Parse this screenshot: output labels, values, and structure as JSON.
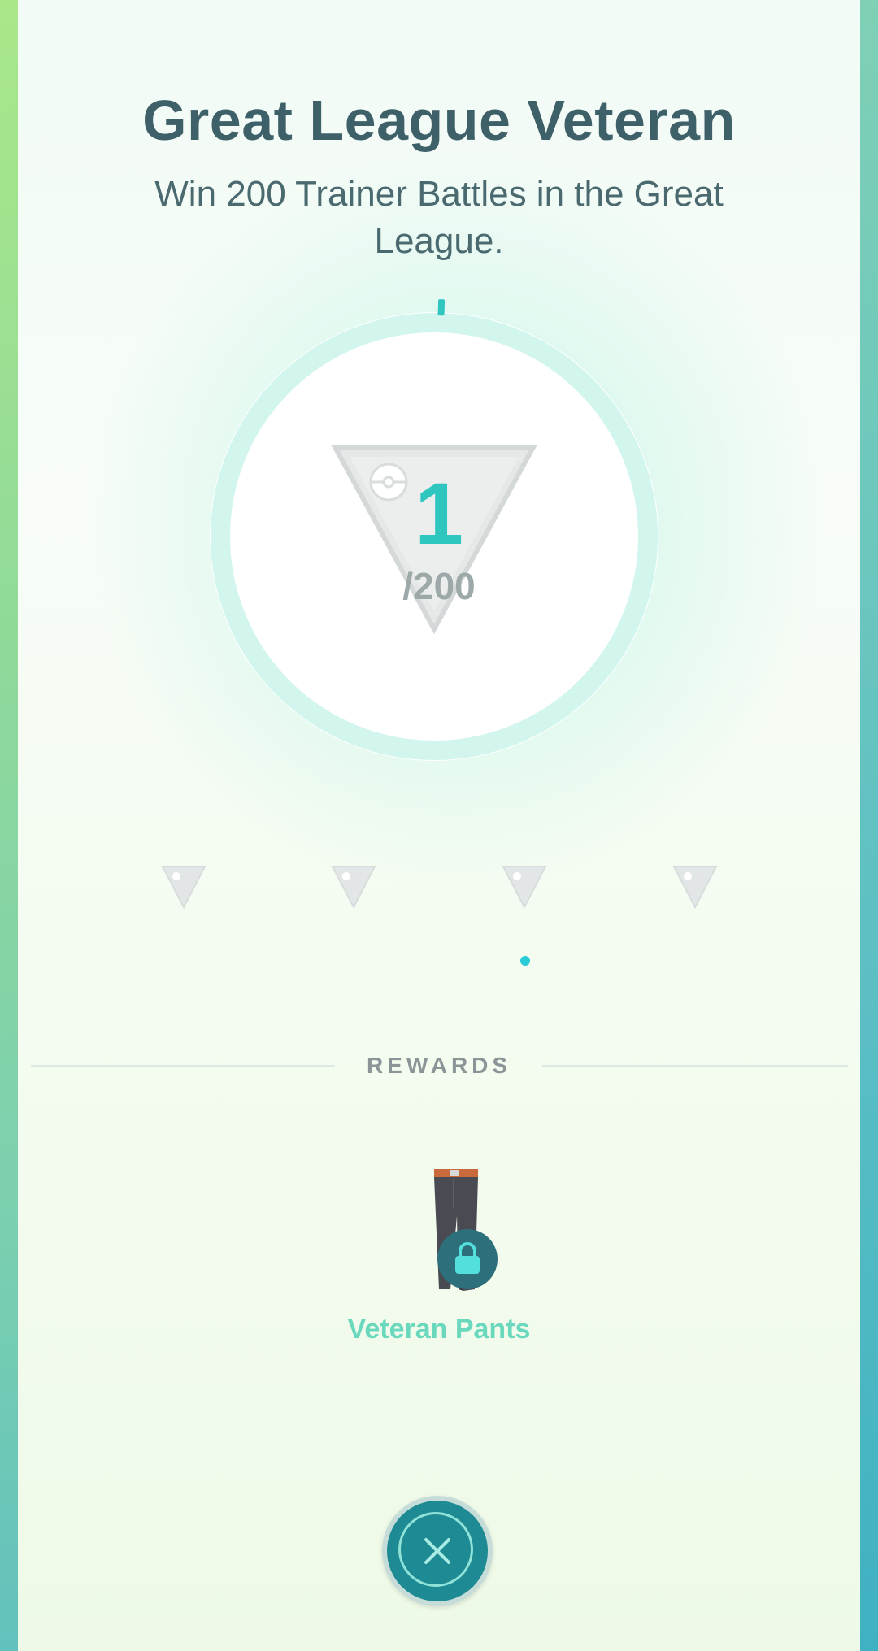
{
  "medal": {
    "title": "Great League Veteran",
    "description": "Win 200 Trainer Battles in the Great League.",
    "progress": {
      "current": "1",
      "total": "/200",
      "fraction": 0.005
    },
    "tiers": [
      {
        "name": "tier-1",
        "state": "locked"
      },
      {
        "name": "tier-2",
        "state": "locked"
      },
      {
        "name": "tier-3",
        "state": "locked"
      },
      {
        "name": "tier-4",
        "state": "locked"
      }
    ],
    "pagination": {
      "current_page": 1,
      "total_pages": 1
    }
  },
  "rewards": {
    "label": "REWARDS",
    "items": [
      {
        "name": "Veteran Pants",
        "icon": "pants-icon",
        "locked": true,
        "badge_icon": "lock-icon"
      }
    ]
  },
  "close_button": {
    "icon": "close-icon"
  },
  "colors": {
    "accent": "#2fc6c0",
    "title": "#3e6069",
    "reward_name": "#6ad8bd",
    "close_button": "#1e8b94"
  }
}
